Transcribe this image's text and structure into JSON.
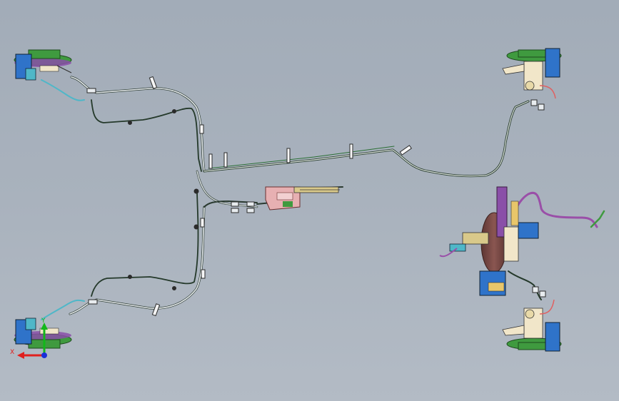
{
  "scene": {
    "background_top": "#a2acb8",
    "background_bottom": "#b3bbc5"
  },
  "colors": {
    "tube_light": "#e8ecef",
    "tube_dark": "#2f3f35",
    "hose_teal": "#4fb7c8",
    "rotor": "#7a4a46",
    "knuckle": "#f1e6c9",
    "caliper_blue": "#2f73c9",
    "hub_green": "#3f9a3f",
    "pipe_purple": "#9a4fa8",
    "parking_brake": "#e7b0b2"
  },
  "axis_triad": {
    "x_label": "X",
    "y_label": "Y",
    "x_color": "#e0201e",
    "y_color": "#12b81a",
    "z_color": "#1a2fd8",
    "x_icon": "axis-x-arrow-icon",
    "y_icon": "axis-y-arrow-icon",
    "z_icon": "axis-z-dot-icon"
  }
}
